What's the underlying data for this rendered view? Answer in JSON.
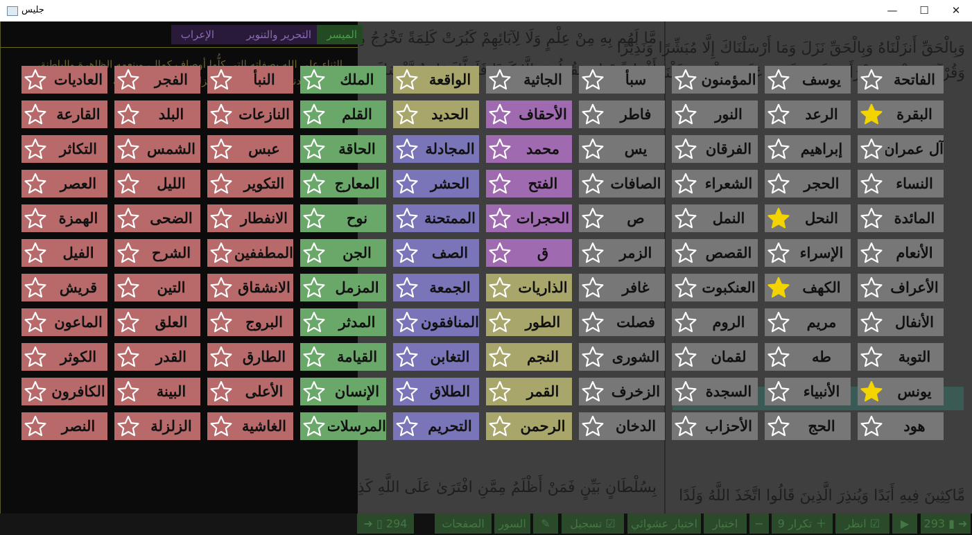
{
  "window": {
    "title": "جليس",
    "minimize": "—",
    "maximize": "☐",
    "close": "✕"
  },
  "colors": {
    "gray": "#777777",
    "red": "#b86a6a",
    "green": "#6aa86a",
    "olive": "#a8a66a",
    "purple": "#a06ab0",
    "blue": "#7a74b8",
    "star_filled": "#f4d400"
  },
  "tafsir": {
    "tabs": [
      "الميسر",
      "التحرير والتنوير",
      "الإعراب"
    ],
    "text": "الثناء على الله بصفاته التي كلُّها أوصاف كمال، وبنعمه الظاهرة والباطنة، الدينية والدنيوية، الذي تفضَّل فأنزل على عبده ورسوله"
  },
  "quran": {
    "right_lines": [
      "وَبِالْحَقِّ أَنزَلْنَاهُ وَبِالْحَقِّ نَزَلَ وَمَا أَرْسَلْنَاكَ إِلَّا مُبَشِّرًا وَنَذِيرًا",
      "وَقُرْآنًا فَرَقْنَاهُ لِتَقْرَأَهُ عَلَى النَّاسِ عَلَىٰ مُكْثٍ وَنَزَّلْنَاهُ تَنزِيلًا"
    ],
    "left_lines": [
      "مَّا لَهُم بِهِ مِنْ عِلْمٍ وَلَا لِآبَائِهِمْ كَبُرَتْ كَلِمَةً تَخْرُجُ مِنْ",
      "أَفْوَاهِهِمْ إِن يَقُولُونَ إِلَّا كَذِبًا فَلَعَلَّكَ بَاخِعٌ نَّفْسَكَ"
    ],
    "bottom_right": "مَّاكِثِينَ فِيهِ أَبَدًا وَيُنذِرَ الَّذِينَ قَالُوا اتَّخَذَ اللَّهُ وَلَدًا",
    "bottom_left": "بِسُلْطَانٍ بَيِّنٍ فَمَنْ أَظْلَمُ مِمَّنِ افْتَرَىٰ عَلَى اللَّهِ كَذِبًا"
  },
  "bottom_bar": {
    "page_right": "293",
    "review": "انظر",
    "repeat": "تكرار 9",
    "choose": "اختيار",
    "random": "اختيار عشوائي",
    "record": "تسجيل",
    "surahs": "السور",
    "pages": "الصفحات",
    "page_left": "294"
  },
  "surahs": [
    {
      "name": "الفاتحة",
      "color": "gray",
      "starred": false
    },
    {
      "name": "البقرة",
      "color": "gray",
      "starred": true
    },
    {
      "name": "آل عمران",
      "color": "gray",
      "starred": false
    },
    {
      "name": "النساء",
      "color": "gray",
      "starred": false
    },
    {
      "name": "المائدة",
      "color": "gray",
      "starred": false
    },
    {
      "name": "الأنعام",
      "color": "gray",
      "starred": false
    },
    {
      "name": "الأعراف",
      "color": "gray",
      "starred": false
    },
    {
      "name": "الأنفال",
      "color": "gray",
      "starred": false
    },
    {
      "name": "التوبة",
      "color": "gray",
      "starred": false
    },
    {
      "name": "يونس",
      "color": "gray",
      "starred": true
    },
    {
      "name": "هود",
      "color": "gray",
      "starred": false
    },
    {
      "name": "يوسف",
      "color": "gray",
      "starred": false
    },
    {
      "name": "الرعد",
      "color": "gray",
      "starred": false
    },
    {
      "name": "إبراهيم",
      "color": "gray",
      "starred": false
    },
    {
      "name": "الحجر",
      "color": "gray",
      "starred": false
    },
    {
      "name": "النحل",
      "color": "gray",
      "starred": true
    },
    {
      "name": "الإسراء",
      "color": "gray",
      "starred": false
    },
    {
      "name": "الكهف",
      "color": "gray",
      "starred": true
    },
    {
      "name": "مريم",
      "color": "gray",
      "starred": false
    },
    {
      "name": "طه",
      "color": "gray",
      "starred": false
    },
    {
      "name": "الأنبياء",
      "color": "gray",
      "starred": false
    },
    {
      "name": "الحج",
      "color": "gray",
      "starred": false
    },
    {
      "name": "المؤمنون",
      "color": "gray",
      "starred": false
    },
    {
      "name": "النور",
      "color": "gray",
      "starred": false
    },
    {
      "name": "الفرقان",
      "color": "gray",
      "starred": false
    },
    {
      "name": "الشعراء",
      "color": "gray",
      "starred": false
    },
    {
      "name": "النمل",
      "color": "gray",
      "starred": false
    },
    {
      "name": "القصص",
      "color": "gray",
      "starred": false
    },
    {
      "name": "العنكبوت",
      "color": "gray",
      "starred": false
    },
    {
      "name": "الروم",
      "color": "gray",
      "starred": false
    },
    {
      "name": "لقمان",
      "color": "gray",
      "starred": false
    },
    {
      "name": "السجدة",
      "color": "gray",
      "starred": false
    },
    {
      "name": "الأحزاب",
      "color": "gray",
      "starred": false
    },
    {
      "name": "سبأ",
      "color": "gray",
      "starred": false
    },
    {
      "name": "فاطر",
      "color": "gray",
      "starred": false
    },
    {
      "name": "يس",
      "color": "gray",
      "starred": false
    },
    {
      "name": "الصافات",
      "color": "gray",
      "starred": false
    },
    {
      "name": "ص",
      "color": "gray",
      "starred": false
    },
    {
      "name": "الزمر",
      "color": "gray",
      "starred": false
    },
    {
      "name": "غافر",
      "color": "gray",
      "starred": false
    },
    {
      "name": "فصلت",
      "color": "gray",
      "starred": false
    },
    {
      "name": "الشورى",
      "color": "gray",
      "starred": false
    },
    {
      "name": "الزخرف",
      "color": "gray",
      "starred": false
    },
    {
      "name": "الدخان",
      "color": "gray",
      "starred": false
    },
    {
      "name": "الجاثية",
      "color": "gray",
      "starred": false
    },
    {
      "name": "الأحقاف",
      "color": "purple",
      "starred": false
    },
    {
      "name": "محمد",
      "color": "purple",
      "starred": false
    },
    {
      "name": "الفتح",
      "color": "purple",
      "starred": false
    },
    {
      "name": "الحجرات",
      "color": "purple",
      "starred": false
    },
    {
      "name": "ق",
      "color": "purple",
      "starred": false
    },
    {
      "name": "الذاريات",
      "color": "olive",
      "starred": false
    },
    {
      "name": "الطور",
      "color": "olive",
      "starred": false
    },
    {
      "name": "النجم",
      "color": "olive",
      "starred": false
    },
    {
      "name": "القمر",
      "color": "olive",
      "starred": false
    },
    {
      "name": "الرحمن",
      "color": "olive",
      "starred": false
    },
    {
      "name": "الواقعة",
      "color": "olive",
      "starred": false
    },
    {
      "name": "الحديد",
      "color": "olive",
      "starred": false
    },
    {
      "name": "المجادلة",
      "color": "blue",
      "starred": false
    },
    {
      "name": "الحشر",
      "color": "blue",
      "starred": false
    },
    {
      "name": "الممتحنة",
      "color": "blue",
      "starred": false
    },
    {
      "name": "الصف",
      "color": "blue",
      "starred": false
    },
    {
      "name": "الجمعة",
      "color": "blue",
      "starred": false
    },
    {
      "name": "المنافقون",
      "color": "blue",
      "starred": false
    },
    {
      "name": "التغابن",
      "color": "blue",
      "starred": false
    },
    {
      "name": "الطلاق",
      "color": "blue",
      "starred": false
    },
    {
      "name": "التحريم",
      "color": "blue",
      "starred": false
    },
    {
      "name": "الملك",
      "color": "green",
      "starred": false
    },
    {
      "name": "القلم",
      "color": "green",
      "starred": false
    },
    {
      "name": "الحاقة",
      "color": "green",
      "starred": false
    },
    {
      "name": "المعارج",
      "color": "green",
      "starred": false
    },
    {
      "name": "نوح",
      "color": "green",
      "starred": false
    },
    {
      "name": "الجن",
      "color": "green",
      "starred": false
    },
    {
      "name": "المزمل",
      "color": "green",
      "starred": false
    },
    {
      "name": "المدثر",
      "color": "green",
      "starred": false
    },
    {
      "name": "القيامة",
      "color": "green",
      "starred": false
    },
    {
      "name": "الإنسان",
      "color": "green",
      "starred": false
    },
    {
      "name": "المرسلات",
      "color": "green",
      "starred": false
    },
    {
      "name": "النبأ",
      "color": "red",
      "starred": false
    },
    {
      "name": "النازعات",
      "color": "red",
      "starred": false
    },
    {
      "name": "عبس",
      "color": "red",
      "starred": false
    },
    {
      "name": "التكوير",
      "color": "red",
      "starred": false
    },
    {
      "name": "الانفطار",
      "color": "red",
      "starred": false
    },
    {
      "name": "المطففين",
      "color": "red",
      "starred": false
    },
    {
      "name": "الانشقاق",
      "color": "red",
      "starred": false
    },
    {
      "name": "البروج",
      "color": "red",
      "starred": false
    },
    {
      "name": "الطارق",
      "color": "red",
      "starred": false
    },
    {
      "name": "الأعلى",
      "color": "red",
      "starred": false
    },
    {
      "name": "الغاشية",
      "color": "red",
      "starred": false
    },
    {
      "name": "الفجر",
      "color": "red",
      "starred": false
    },
    {
      "name": "البلد",
      "color": "red",
      "starred": false
    },
    {
      "name": "الشمس",
      "color": "red",
      "starred": false
    },
    {
      "name": "الليل",
      "color": "red",
      "starred": false
    },
    {
      "name": "الضحى",
      "color": "red",
      "starred": false
    },
    {
      "name": "الشرح",
      "color": "red",
      "starred": false
    },
    {
      "name": "التين",
      "color": "red",
      "starred": false
    },
    {
      "name": "العلق",
      "color": "red",
      "starred": false
    },
    {
      "name": "القدر",
      "color": "red",
      "starred": false
    },
    {
      "name": "البينة",
      "color": "red",
      "starred": false
    },
    {
      "name": "الزلزلة",
      "color": "red",
      "starred": false
    },
    {
      "name": "العاديات",
      "color": "red",
      "starred": false
    },
    {
      "name": "القارعة",
      "color": "red",
      "starred": false
    },
    {
      "name": "التكاثر",
      "color": "red",
      "starred": false
    },
    {
      "name": "العصر",
      "color": "red",
      "starred": false
    },
    {
      "name": "الهمزة",
      "color": "red",
      "starred": false
    },
    {
      "name": "الفيل",
      "color": "red",
      "starred": false
    },
    {
      "name": "قريش",
      "color": "red",
      "starred": false
    },
    {
      "name": "الماعون",
      "color": "red",
      "starred": false
    },
    {
      "name": "الكوثر",
      "color": "red",
      "starred": false
    },
    {
      "name": "الكافرون",
      "color": "red",
      "starred": false
    },
    {
      "name": "النصر",
      "color": "red",
      "starred": false
    }
  ]
}
